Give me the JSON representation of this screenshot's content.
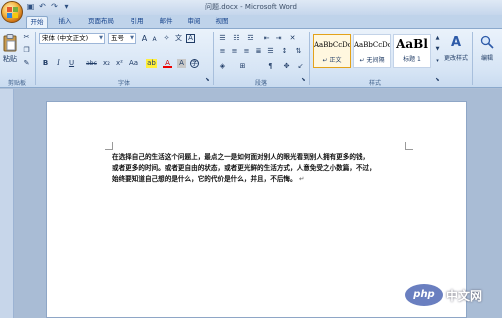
{
  "window": {
    "title": "问题.docx - Microsoft Word"
  },
  "quick_access": {
    "icons": [
      "save-icon",
      "undo-icon",
      "redo-icon",
      "customize-icon"
    ],
    "undo_glyph": "↶",
    "redo_glyph": "↷",
    "save_glyph": "▣",
    "dropdown_glyph": "▾"
  },
  "tabs": [
    {
      "label": "开始",
      "active": true
    },
    {
      "label": "插入"
    },
    {
      "label": "页面布局"
    },
    {
      "label": "引用"
    },
    {
      "label": "邮件"
    },
    {
      "label": "审阅"
    },
    {
      "label": "视图"
    }
  ],
  "ribbon": {
    "clipboard": {
      "label": "剪贴板",
      "paste_label": "粘贴"
    },
    "font": {
      "label": "字体",
      "font_name": "宋体 (中文正文)",
      "font_size": "五号",
      "grow_glyph": "A",
      "shrink_glyph": "A",
      "bold": "B",
      "italic": "I",
      "underline": "U",
      "strike": "abc",
      "subscript": "x₂",
      "superscript": "x²",
      "change_case": "Aa",
      "font_color": "A",
      "highlight": "ab",
      "char_border": "A",
      "wen": "文"
    },
    "paragraph": {
      "label": "段落"
    },
    "styles": {
      "label": "样式",
      "items": [
        {
          "sample": "AaBbCcDc",
          "name": "↵ 正文",
          "selected": true
        },
        {
          "sample": "AaBbCcDc",
          "name": "↵ 无间隔"
        },
        {
          "sample": "AaBl",
          "name": "标题 1"
        }
      ],
      "change_styles": "更改样式"
    },
    "editing": {
      "label": "编辑"
    }
  },
  "document": {
    "lines": [
      "在选择自己的生活这个问题上，最点之一是如何面对别人的眼光看到别人拥有更多的钱，",
      "或者更多的时间。或者更自由的状态，或者更光鲜的生活方式，人意免受之小数篇，不过，",
      "始终要知道自己想的是什么，它的代价是什么，并且，不后悔。"
    ],
    "paragraph_mark": "↵"
  },
  "watermark": {
    "logo_text": "php",
    "text": "中文网"
  }
}
